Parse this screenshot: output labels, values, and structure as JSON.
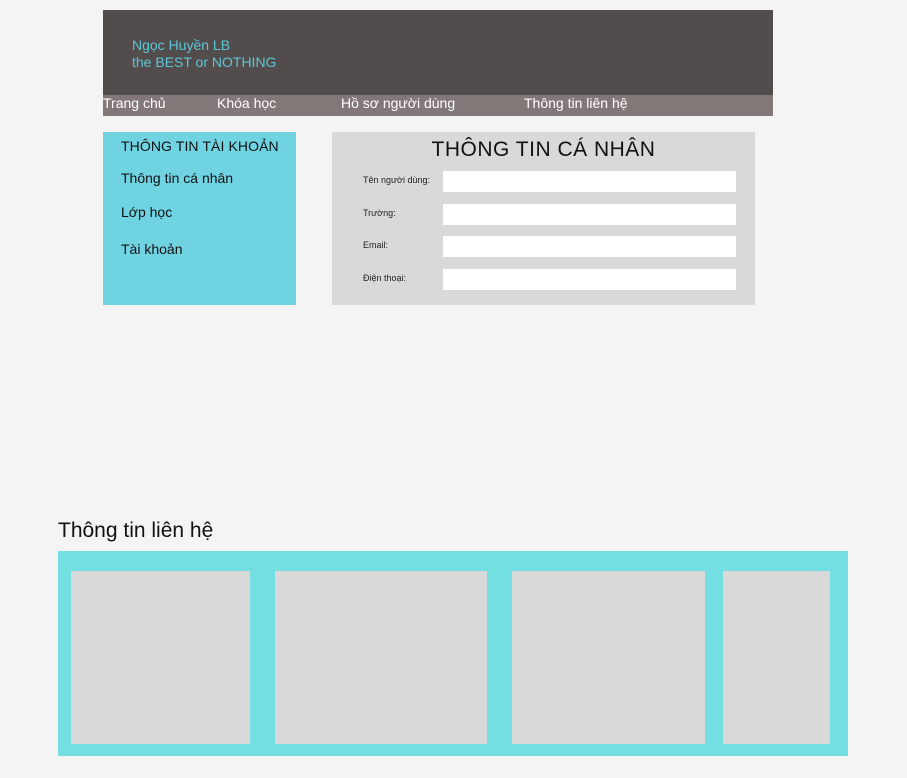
{
  "header": {
    "brand_name": "Ngọc Huyền LB",
    "brand_tagline": "the BEST or NOTHING"
  },
  "nav": {
    "items": [
      "Trang chủ",
      "Khóa học",
      "Hồ sơ người dùng",
      "Thông tin liên hệ"
    ]
  },
  "sidebar": {
    "heading": "THÔNG TIN TÀI KHOẢN",
    "items": [
      "Thông tin cá nhân",
      "Lớp học",
      "Tài khoản"
    ]
  },
  "profile": {
    "title": "THÔNG TIN CÁ NHÂN",
    "fields": [
      {
        "label": "Tên người dùng:",
        "value": "",
        "placeholder": ""
      },
      {
        "label": "Trường:",
        "value": "",
        "placeholder": ""
      },
      {
        "label": "Email:",
        "value": "",
        "placeholder": ""
      },
      {
        "label": "Điện thoại:",
        "value": "",
        "placeholder": ""
      }
    ]
  },
  "contact": {
    "title": "Thông tin liên hệ"
  },
  "colors": {
    "header_bg": "#524c4c",
    "nav_bg": "#837878",
    "brand_text": "#5cc6d6",
    "sidebar_bg": "#6fd3e2",
    "panel_bg": "#d9d9d9",
    "contact_band": "#74dfe2"
  }
}
